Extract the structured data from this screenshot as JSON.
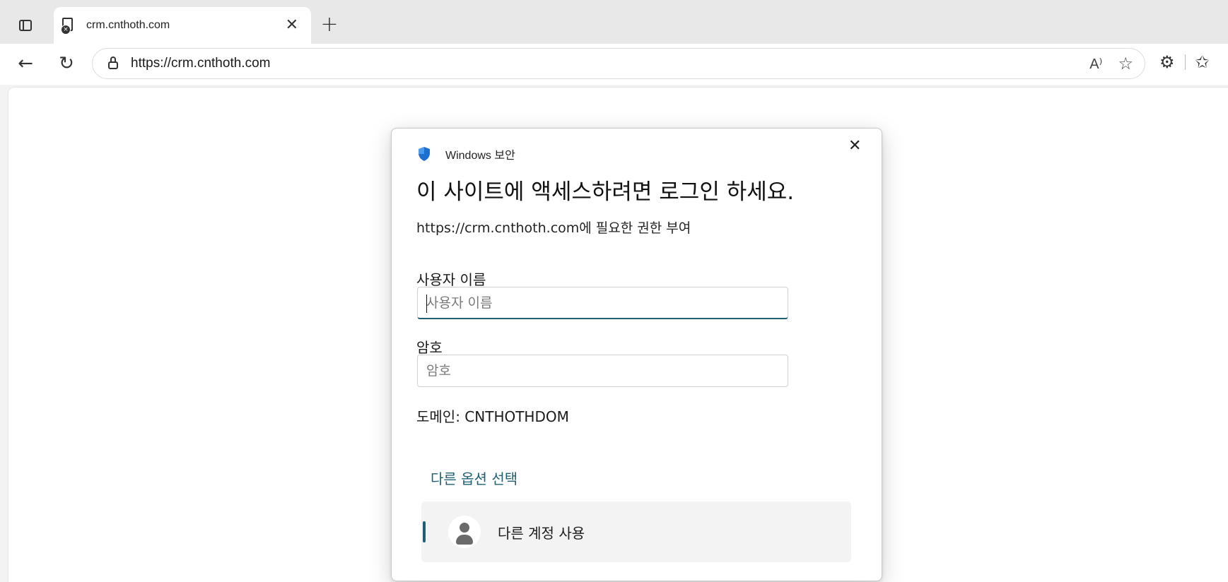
{
  "browser": {
    "tab": {
      "title": "crm.cnthoth.com",
      "close": "✕"
    },
    "new_tab": "+",
    "address": {
      "url": "https://crm.cnthoth.com"
    },
    "read_aloud": "A⁾",
    "icons": {
      "back": "back-arrow-icon",
      "refresh": "refresh-icon",
      "lock": "lock-icon",
      "favorite": "star-icon",
      "extensions": "extensions-icon",
      "favorites_bar": "favorites-icon"
    }
  },
  "dialog": {
    "app_name": "Windows 보안",
    "title": "이 사이트에 액세스하려면 로그인 하세요.",
    "subtitle": "https://crm.cnthoth.com에 필요한 권한 부여",
    "username": {
      "label": "사용자 이름",
      "placeholder": "사용자 이름",
      "value": ""
    },
    "password": {
      "label": "암호",
      "placeholder": "암호",
      "value": ""
    },
    "domain": "도메인: CNTHOTHDOM",
    "other_options": "다른 옵션 선택",
    "options": [
      {
        "label": "다른 계정 사용"
      }
    ],
    "close": "✕",
    "accent_color": "#1e5f71",
    "shield_color": "#1f6fd0"
  }
}
